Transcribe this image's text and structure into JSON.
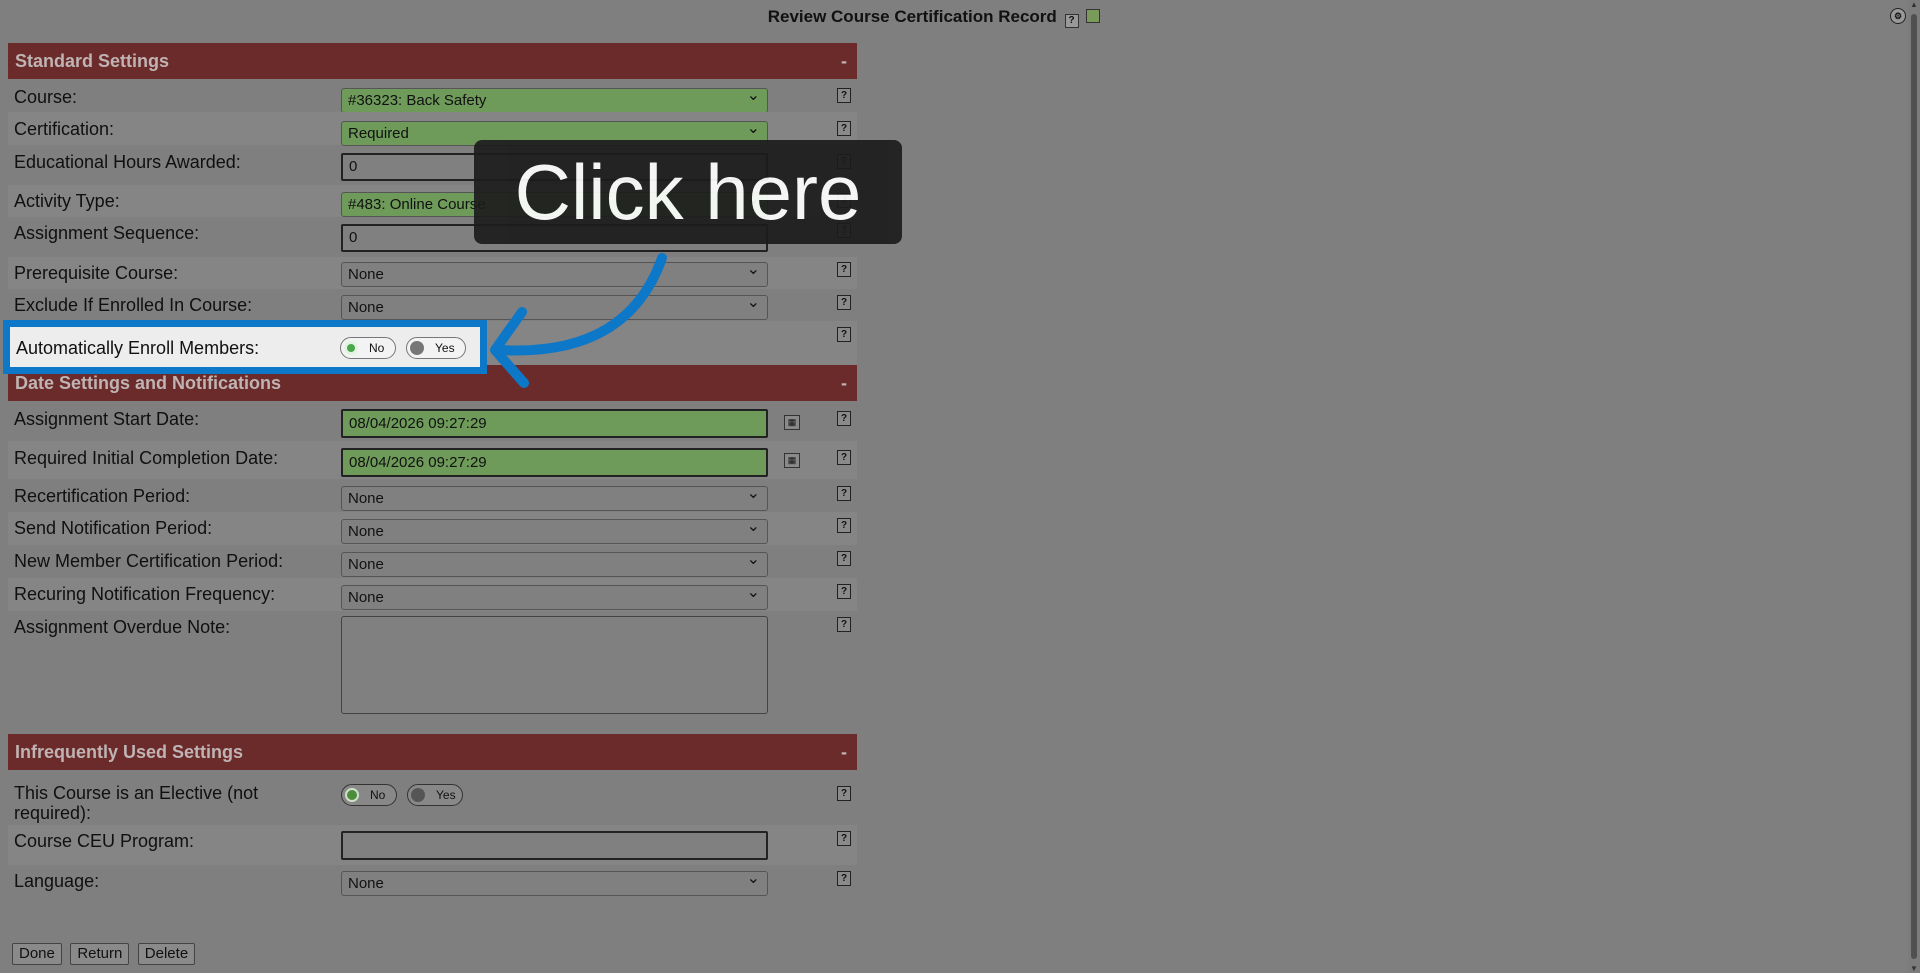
{
  "page": {
    "title": "Review Course Certification Record",
    "help_glyph": "?",
    "image_icon": "image-icon",
    "top_right_icon": "settings-icon"
  },
  "sections": {
    "standard": {
      "title": "Standard Settings",
      "collapse": "-"
    },
    "date": {
      "title": "Date Settings and Notifications",
      "collapse": "-"
    },
    "infrequent": {
      "title": "Infrequently Used Settings",
      "collapse": "-"
    }
  },
  "standard": {
    "course_label": "Course:",
    "course_value": "#36323: Back Safety",
    "certification_label": "Certification:",
    "certification_value": "Required",
    "edu_hours_label": "Educational Hours Awarded:",
    "edu_hours_value": "0",
    "activity_type_label": "Activity Type:",
    "activity_type_value": "#483: Online Course",
    "sequence_label": "Assignment Sequence:",
    "sequence_value": "0",
    "prereq_label": "Prerequisite Course:",
    "prereq_value": "None",
    "exclude_label": "Exclude If Enrolled In Course:",
    "exclude_value": "None",
    "auto_enroll_label": "Automatically Enroll Members:",
    "toggle_no": "No",
    "toggle_yes": "Yes"
  },
  "date": {
    "start_label": "Assignment Start Date:",
    "start_value": "08/04/2026 09:27:29",
    "completion_label": "Required Initial Completion Date:",
    "completion_value": "08/04/2026 09:27:29",
    "recert_label": "Recertification Period:",
    "recert_value": "None",
    "send_notif_label": "Send Notification Period:",
    "send_notif_value": "None",
    "new_member_label": "New Member Certification Period:",
    "new_member_value": "None",
    "recurring_label": "Recuring Notification Frequency:",
    "recurring_value": "None",
    "overdue_label": "Assignment Overdue Note:",
    "overdue_value": ""
  },
  "infrequent": {
    "elective_label": "This Course is an Elective (not required):",
    "toggle_no": "No",
    "toggle_yes": "Yes",
    "ceu_label": "Course CEU Program:",
    "ceu_value": "",
    "language_label": "Language:",
    "language_value": "None"
  },
  "buttons": {
    "done": "Done",
    "return": "Return",
    "delete": "Delete"
  },
  "overlay": {
    "callout_text": "Click here",
    "accent_color": "#0e78c8"
  }
}
